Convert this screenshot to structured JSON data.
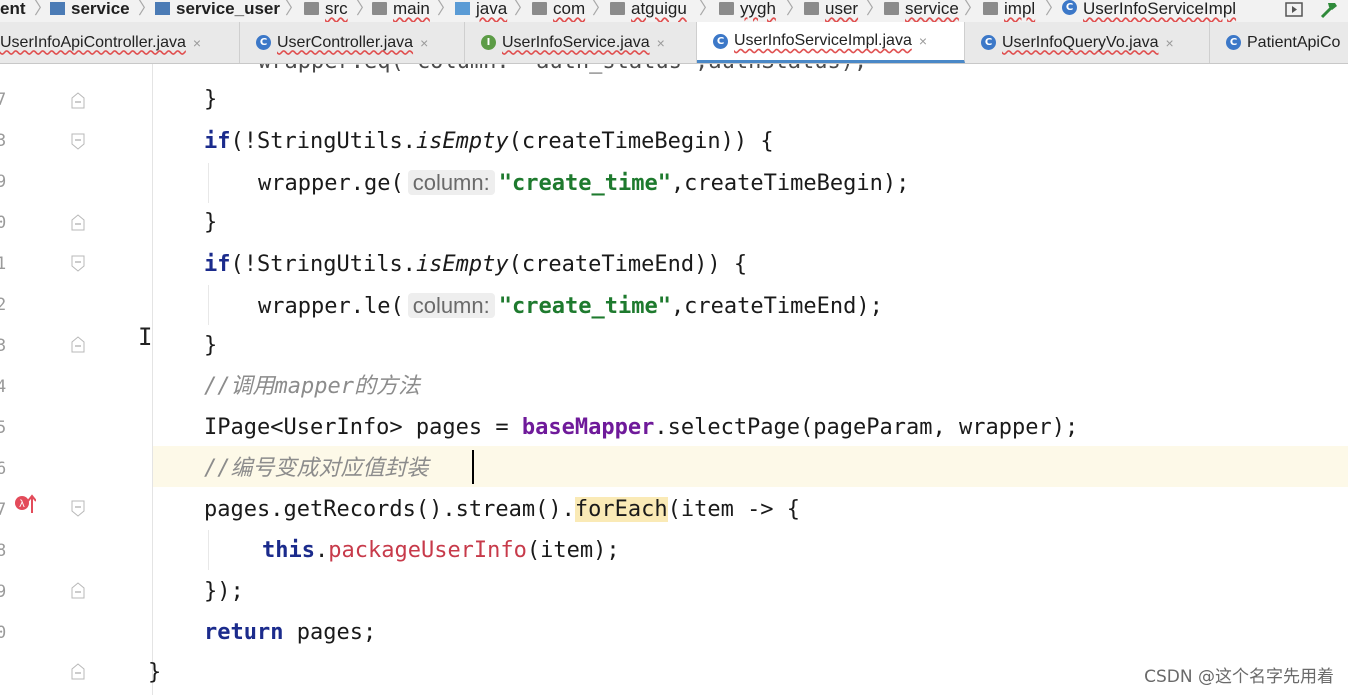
{
  "breadcrumb": [
    {
      "label": "ent",
      "kind": "text",
      "bold": true
    },
    {
      "label": "service",
      "kind": "mod",
      "bold": true
    },
    {
      "label": "service_user",
      "kind": "mod",
      "bold": true
    },
    {
      "label": "src",
      "kind": "pkg"
    },
    {
      "label": "main",
      "kind": "pkg"
    },
    {
      "label": "java",
      "kind": "blue"
    },
    {
      "label": "com",
      "kind": "pkg"
    },
    {
      "label": "atguigu",
      "kind": "pkg"
    },
    {
      "label": "yygh",
      "kind": "pkg"
    },
    {
      "label": "user",
      "kind": "pkg"
    },
    {
      "label": "service",
      "kind": "pkg"
    },
    {
      "label": "impl",
      "kind": "pkg"
    },
    {
      "label": "UserInfoServiceImpl",
      "kind": "class"
    }
  ],
  "tabs": [
    {
      "label": "UserInfoApiController.java",
      "icon": "none",
      "active": false
    },
    {
      "label": "UserController.java",
      "icon": "class-icon",
      "active": false
    },
    {
      "label": "UserInfoService.java",
      "icon": "interface-icon",
      "active": false
    },
    {
      "label": "UserInfoServiceImpl.java",
      "icon": "class-icon",
      "active": true
    },
    {
      "label": "UserInfoQueryVo.java",
      "icon": "class-icon",
      "active": false
    },
    {
      "label": "PatientApiCo",
      "icon": "class-icon",
      "active": false
    }
  ],
  "close_glyph": "×",
  "line_numbers": [
    "7",
    "3",
    "9",
    "0",
    "1",
    "2",
    "3",
    "4",
    "5",
    "6",
    "7",
    "8",
    "9",
    "0"
  ],
  "code": {
    "line0": "wrapper.eq( column: \"auth_status\",authStatus);",
    "line1": "}",
    "line2_kw": "if",
    "line2_a": "(!StringUtils.",
    "line2_it": "isEmpty",
    "line2_b": "(createTimeBegin)) {",
    "line3_a": "wrapper.ge(",
    "line3_hint": "column:",
    "line3_str": "\"create_time\"",
    "line3_b": ",createTimeBegin);",
    "line4": "}",
    "line5_kw": "if",
    "line5_a": "(!StringUtils.",
    "line5_it": "isEmpty",
    "line5_b": "(createTimeEnd)) {",
    "line6_a": "wrapper.le(",
    "line6_hint": "column:",
    "line6_str": "\"create_time\"",
    "line6_b": ",createTimeEnd);",
    "line7": "}",
    "line8_cmt": "//调用mapper的方法",
    "line9_a": "IPage<UserInfo> pages = ",
    "line9_field": "baseMapper",
    "line9_b": ".selectPage(pageParam, wrapper);",
    "line10_cmt": "//编号变成对应值封装",
    "line11_a": "pages.getRecords().stream().",
    "line11_warn": "forEach",
    "line11_b": "(item -> {",
    "line12_kw": "this",
    "line12_a": ".",
    "line12_red": "packageUserInfo",
    "line12_b": "(item);",
    "line13": "});",
    "line14_kw": "return",
    "line14_a": " pages;",
    "line15": "}"
  },
  "watermark": "CSDN @这个名字先用着",
  "colors": {
    "keyword": "#1b2b8c",
    "string": "#1e7a2e",
    "field": "#6f1a9a",
    "comment": "#8c8c8c",
    "method_red": "#c73a4a",
    "line_highlight": "#fdf9e8",
    "active_tab_underline": "#4a88c7"
  }
}
